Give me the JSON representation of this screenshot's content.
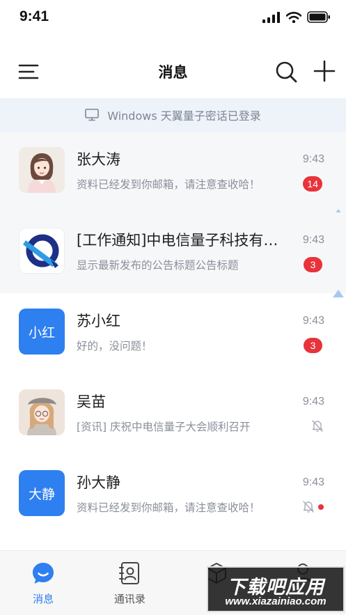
{
  "status_bar": {
    "time": "9:41"
  },
  "header": {
    "title": "消息"
  },
  "login_banner": {
    "text": "Windows 天翼量子密话已登录"
  },
  "conversations": [
    {
      "name": "张大涛",
      "preview": "资料已经发到你邮箱，请注意查收哈！",
      "time": "9:43",
      "unread": "14",
      "avatar_type": "photo-woman",
      "pinned": true
    },
    {
      "name": "[工作通知]中电信量子科技有限公司",
      "preview": "显示最新发布的公告标题公告标题",
      "time": "9:43",
      "unread": "3",
      "avatar_type": "logo",
      "pinned": true
    },
    {
      "name": "苏小红",
      "preview": "好的，没问题！",
      "time": "9:43",
      "unread": "3",
      "avatar_type": "text",
      "avatar_text": "小红",
      "pinned": false
    },
    {
      "name": "吴苗",
      "preview": "[资讯] 庆祝中电信量子大会顺利召开",
      "time": "9:43",
      "muted": true,
      "avatar_type": "photo-girl",
      "pinned": false
    },
    {
      "name": "孙大静",
      "preview": "资料已经发到你邮箱，请注意查收哈！",
      "time": "9:43",
      "muted": true,
      "has_dot": true,
      "avatar_type": "text",
      "avatar_text": "大静",
      "pinned": false
    }
  ],
  "tabs": [
    {
      "label": "消息",
      "icon": "chat-bubble-icon",
      "active": true
    },
    {
      "label": "通讯录",
      "icon": "contacts-icon",
      "active": false
    },
    {
      "label": "",
      "icon": "box-icon",
      "active": false
    },
    {
      "label": "",
      "icon": "person-icon",
      "active": false
    }
  ],
  "watermark": {
    "title": "下载吧应用",
    "url": "www.xiazainiao.com"
  },
  "colors": {
    "accent": "#2e7ff0",
    "badge": "#e7333b",
    "banner_bg": "#eef3fa",
    "pinned_bg": "#f6f7f9"
  }
}
